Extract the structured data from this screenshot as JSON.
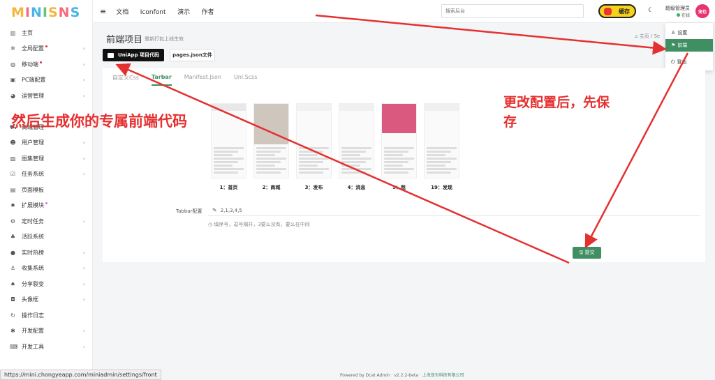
{
  "logo": [
    "M",
    "I",
    "N",
    "I",
    "S",
    "N",
    "S"
  ],
  "sidebar": {
    "items": [
      {
        "label": "主页",
        "icon": "bar-chart-icon",
        "glyph": "▥",
        "chev": false,
        "dot": ""
      },
      {
        "label": "全局配置",
        "icon": "gear-icon",
        "glyph": "✲",
        "chev": true,
        "dot": "red"
      },
      {
        "label": "移动端",
        "icon": "wechat-icon",
        "glyph": "◍",
        "chev": true,
        "dot": "red"
      },
      {
        "label": "PC端配置",
        "icon": "monitor-icon",
        "glyph": "▣",
        "chev": true,
        "dot": ""
      },
      {
        "label": "运营管理",
        "icon": "pie-chart-icon",
        "glyph": "◕",
        "chev": true,
        "dot": ""
      },
      {
        "label": "",
        "icon": "blank-icon",
        "glyph": "",
        "chev": false,
        "dot": ""
      },
      {
        "label": "商城管理",
        "icon": "cart-icon",
        "glyph": "⛟",
        "chev": true,
        "dot": ""
      },
      {
        "label": "用户管理",
        "icon": "users-icon",
        "glyph": "☻",
        "chev": true,
        "dot": ""
      },
      {
        "label": "图集管理",
        "icon": "image-icon",
        "glyph": "▨",
        "chev": true,
        "dot": ""
      },
      {
        "label": "任务系统",
        "icon": "checkbox-icon",
        "glyph": "☑",
        "chev": true,
        "dot": ""
      },
      {
        "label": "页面模板",
        "icon": "template-icon",
        "glyph": "▤",
        "chev": false,
        "dot": ""
      },
      {
        "label": "扩展模块",
        "icon": "puzzle-icon",
        "glyph": "✸",
        "chev": false,
        "dot": "pink"
      },
      {
        "label": "定时任务",
        "icon": "cogs-icon",
        "glyph": "⚙",
        "chev": true,
        "dot": ""
      },
      {
        "label": "活跃系统",
        "icon": "group-icon",
        "glyph": "♣",
        "chev": false,
        "dot": ""
      },
      {
        "label": "实时热榜",
        "icon": "bomb-icon",
        "glyph": "●",
        "chev": true,
        "dot": ""
      },
      {
        "label": "收集系统",
        "icon": "anchor-icon",
        "glyph": "⚓",
        "chev": true,
        "dot": ""
      },
      {
        "label": "分享裂变",
        "icon": "tree-icon",
        "glyph": "♠",
        "chev": true,
        "dot": ""
      },
      {
        "label": "头像框",
        "icon": "frame-icon",
        "glyph": "◘",
        "chev": true,
        "dot": ""
      },
      {
        "label": "操作日志",
        "icon": "history-icon",
        "glyph": "↻",
        "chev": false,
        "dot": ""
      },
      {
        "label": "开发配置",
        "icon": "settings-icon",
        "glyph": "✱",
        "chev": true,
        "dot": ""
      },
      {
        "label": "开发工具",
        "icon": "keyboard-icon",
        "glyph": "⌨",
        "chev": true,
        "dot": ""
      }
    ]
  },
  "topbar": {
    "menu_glyph": "≡",
    "nav": [
      "文档",
      "Iconfont",
      "演示",
      "作者"
    ],
    "search_placeholder": "搜索后台",
    "cache_label": "缓存",
    "moon_glyph": "☾",
    "user_name": "超级管理员",
    "user_status": "在线",
    "avatar_text": "宠也"
  },
  "dropdown": {
    "items": [
      {
        "label": "设置",
        "glyph": "♙",
        "active": false
      },
      {
        "label": "前端",
        "glyph": "⚑",
        "active": true
      },
      {
        "label": "登出",
        "glyph": "⏻",
        "active": false
      }
    ]
  },
  "page": {
    "title": "前端项目",
    "subtitle": "重新打包上线生效",
    "breadcrumb": "⌂ 主页 / Se",
    "btn_uniapp": "UniApp 项目代码",
    "btn_pages": "pages.json文件"
  },
  "card": {
    "tabs": [
      {
        "label": "自定义Css",
        "active": false
      },
      {
        "label": "Tarbar",
        "active": true
      },
      {
        "label": "Manifest.Json",
        "active": false
      },
      {
        "label": "Uni.Scss",
        "active": false
      }
    ],
    "phones": [
      {
        "caption": "1：首页",
        "accent": "#e8e8e8"
      },
      {
        "caption": "2：商城",
        "accent": "#cfc6bd"
      },
      {
        "caption": "3：发布",
        "accent": "#f2f2f2"
      },
      {
        "caption": "4：消息",
        "accent": "#f0f0f0"
      },
      {
        "caption": "5：我",
        "accent": "#d9597f"
      },
      {
        "caption": "19：发现",
        "accent": "#f0f0f0"
      }
    ],
    "tabbar_label": "Tabbar配置",
    "tabbar_value": "2,1,3,4,5",
    "hint": "◷ 填序号，逗号隔开，3要么没有，要么在中间",
    "submit_label": "🖫 提交"
  },
  "footer": {
    "text": "Powered by Dcat Admin · v2.2.2-beta · ",
    "link": "上海宠也科技有限公司"
  },
  "status_url": "https://mini.chongyeapp.com/miniadmin/settings/front",
  "annotations": {
    "left": "然后生成你的专属前端代码",
    "right": "更改配置后，先保存",
    "color": "#e53030"
  }
}
